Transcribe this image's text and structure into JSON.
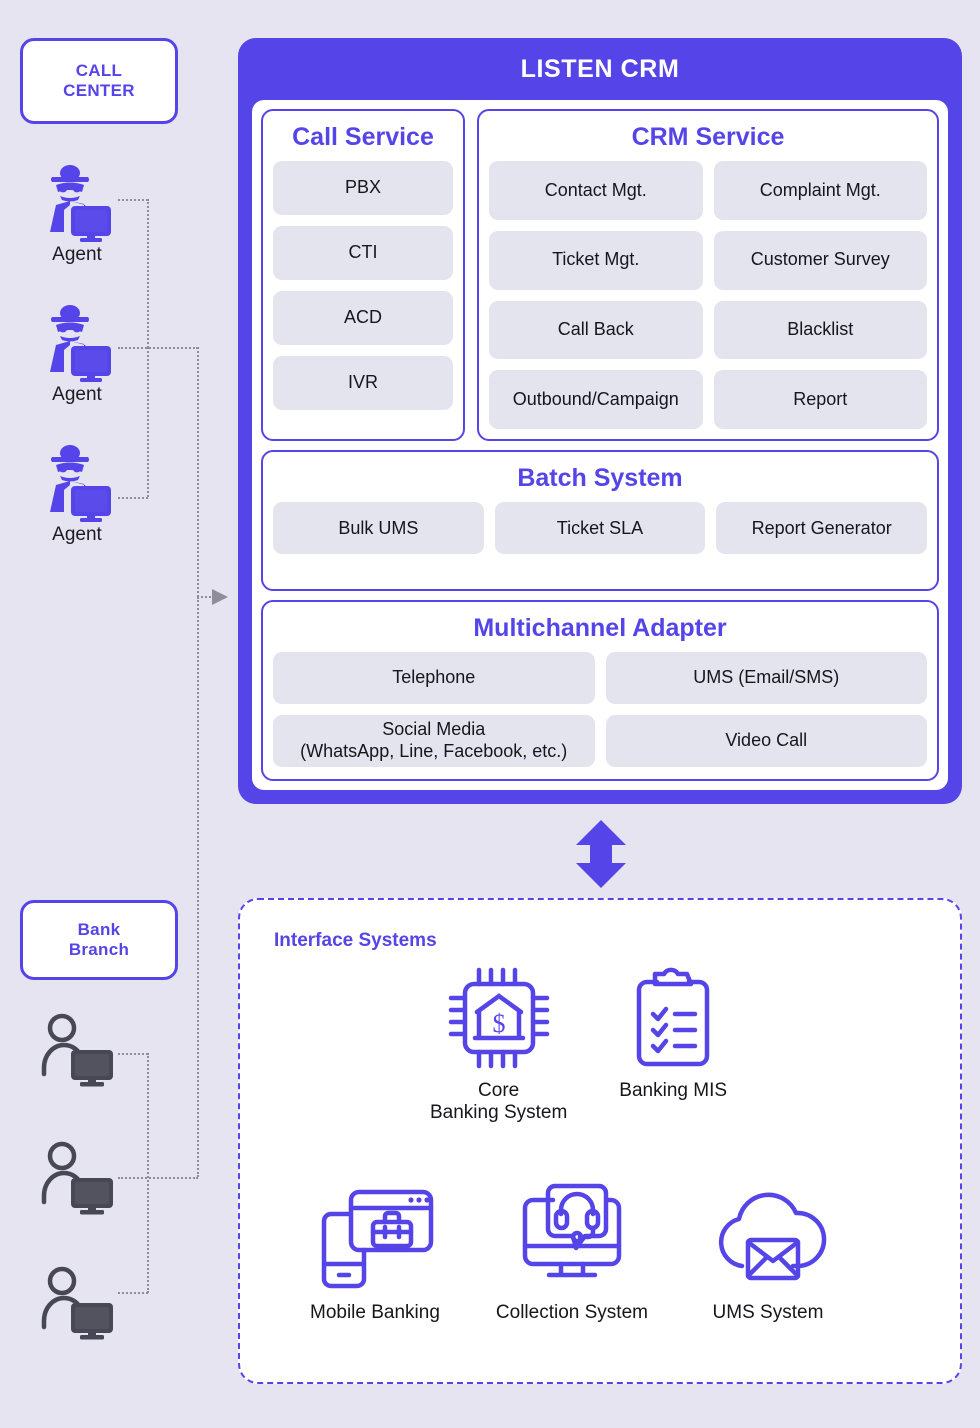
{
  "colors": {
    "brand_purple": "#5544e8",
    "page_background": "#e5e4f0",
    "chip_background": "#e4e4ef",
    "connector_grey": "#8e8e99",
    "branch_icon_grey": "#474755",
    "text_dark": "#16161c"
  },
  "left_column": {
    "call_center": {
      "label": "CALL\nCENTER"
    },
    "bank_branch": {
      "label": "Bank\nBranch"
    },
    "agents": [
      {
        "label": "Agent",
        "icon": "agent-detective-monitor-icon"
      },
      {
        "label": "Agent",
        "icon": "agent-detective-monitor-icon"
      },
      {
        "label": "Agent",
        "icon": "agent-detective-monitor-icon"
      }
    ],
    "branch_users": [
      {
        "icon": "branch-user-monitor-icon"
      },
      {
        "icon": "branch-user-monitor-icon"
      },
      {
        "icon": "branch-user-monitor-icon"
      }
    ]
  },
  "crm": {
    "title": "LISTEN CRM",
    "call_service": {
      "title": "Call Service",
      "items": [
        "PBX",
        "CTI",
        "ACD",
        "IVR"
      ]
    },
    "crm_service": {
      "title": "CRM Service",
      "items": [
        "Contact Mgt.",
        "Complaint Mgt.",
        "Ticket Mgt.",
        "Customer Survey",
        "Call Back",
        "Blacklist",
        "Outbound/Campaign",
        "Report"
      ]
    },
    "batch_system": {
      "title": "Batch System",
      "items": [
        "Bulk UMS",
        "Ticket SLA",
        "Report Generator"
      ]
    },
    "multichannel_adapter": {
      "title": "Multichannel Adapter",
      "items": [
        "Telephone",
        "UMS (Email/SMS)",
        "Social Media\n(WhatsApp, Line, Facebook, etc.)",
        "Video Call"
      ]
    }
  },
  "connector": {
    "crm_to_interface_icon": "double-headed-vertical-arrow-icon",
    "agents_to_crm_icon": "right-arrowhead-icon"
  },
  "interface_systems": {
    "title": "Interface Systems",
    "row1": [
      {
        "label": "Core\nBanking System",
        "icon": "cpu-bank-chip-icon"
      },
      {
        "label": "Banking MIS",
        "icon": "clipboard-checklist-icon"
      }
    ],
    "row2": [
      {
        "label": "Mobile Banking",
        "icon": "mobile-browser-briefcase-icon"
      },
      {
        "label": "Collection System",
        "icon": "monitor-headset-chat-icon"
      },
      {
        "label": "UMS System",
        "icon": "cloud-envelope-icon"
      }
    ]
  }
}
